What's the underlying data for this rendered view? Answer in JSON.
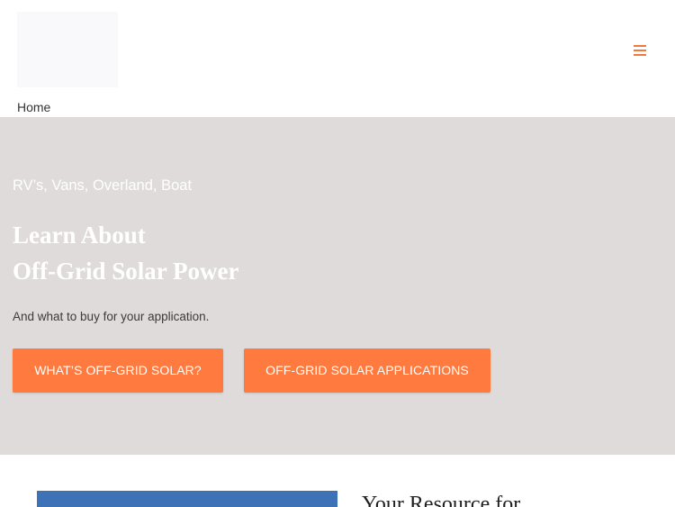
{
  "header": {
    "menu_icon": "hamburger-menu-icon",
    "breadcrumb": "Home"
  },
  "hero": {
    "kicker": "RV’s, Vans, Overland, Boat",
    "title_line1": "Learn About",
    "title_line2": "Off-Grid Solar Power",
    "subtitle": "And what to buy for your application.",
    "buttons": [
      {
        "label": "WHAT’S OFF-GRID SOLAR?"
      },
      {
        "label": "OFF-GRID SOLAR APPLICATIONS"
      }
    ]
  },
  "section": {
    "heading": "Your Resource for"
  },
  "colors": {
    "accent": "#ff7a3f",
    "hero_background": "#dedbda",
    "image_blue": "#3d72b6"
  }
}
